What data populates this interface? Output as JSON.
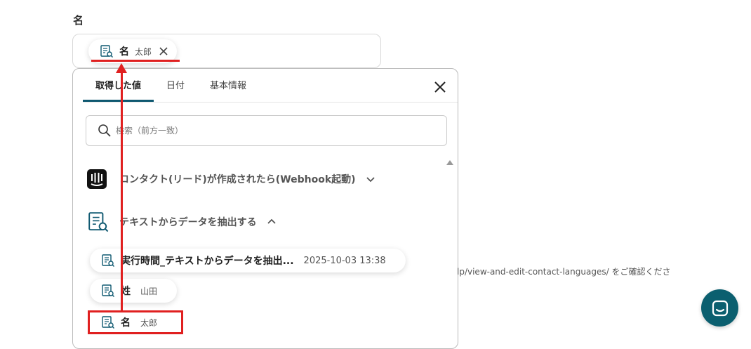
{
  "field": {
    "label": "名"
  },
  "selected_chip": {
    "name": "名",
    "value": "太郎"
  },
  "popup": {
    "tabs": [
      {
        "label": "取得した値"
      },
      {
        "label": "日付"
      },
      {
        "label": "基本情報"
      }
    ],
    "search": {
      "placeholder": "検索（前方一致）"
    },
    "sections": [
      {
        "label": "コンタクト(リード)が作成されたら(Webhook起動)",
        "icon": "intercom-icon",
        "expanded": false
      },
      {
        "label": "テキストからデータを抽出する",
        "icon": "document-search-icon",
        "expanded": true
      }
    ],
    "items": [
      {
        "name": "実行時間_テキストからデータを抽出...",
        "value": "2025-10-03 13:38"
      },
      {
        "name": "姓",
        "value": "山田"
      },
      {
        "name": "名",
        "value": "太郎"
      }
    ]
  },
  "background": {
    "url_text": "lp/view-and-edit-contact-languages/ をご確認くださ"
  },
  "colors": {
    "accent": "#0e5870",
    "annotation_red": "#e02020",
    "chat_button": "#0b5f6f"
  }
}
